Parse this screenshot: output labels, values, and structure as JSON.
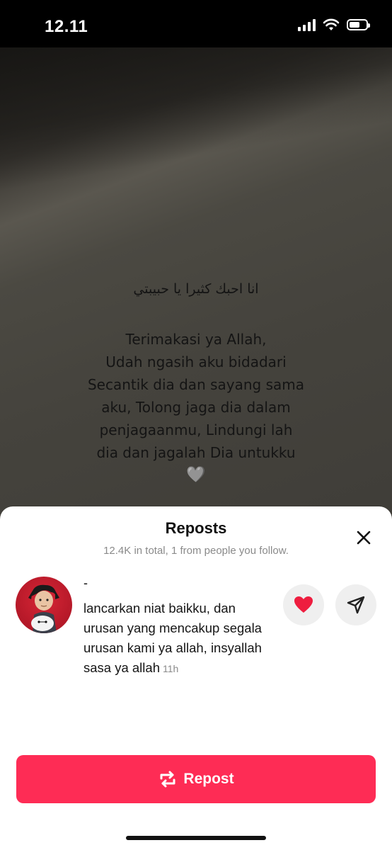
{
  "status_bar": {
    "time": "12.11"
  },
  "video": {
    "arabic_line": "انا احبك كثيرا يا حبيبتي",
    "poem_lines": [
      "Terimakasi ya Allah,",
      "Udah ngasih aku bidadari",
      "Secantik dia dan sayang sama",
      "aku, Tolong jaga dia dalam",
      "penjagaanmu, Lindungi lah",
      "dia dan jagalah Dia untukku"
    ],
    "heart": "🩶"
  },
  "sheet": {
    "title": "Reposts",
    "subtitle": "12.4K in total, 1 from people you follow.",
    "close_icon": "close-icon"
  },
  "comment": {
    "username": "-",
    "text": "lancarkan niat baikku, dan urusan yang mencakup segala urusan kami ya allah, insyallah sasa ya allah",
    "time": "11h"
  },
  "actions": {
    "repost_label": "Repost",
    "accent": "#fe2c55",
    "like_color": "#ee1d3f"
  }
}
